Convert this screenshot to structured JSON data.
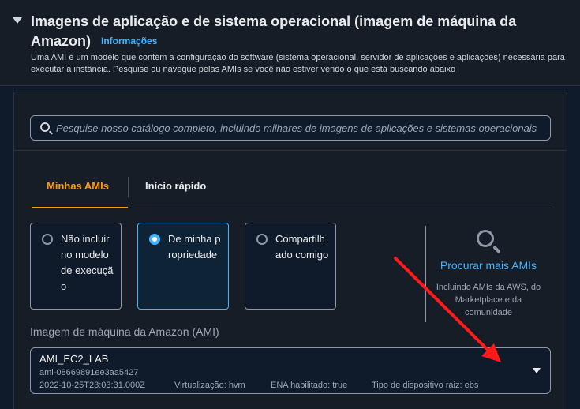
{
  "header": {
    "title": "Imagens de aplicação e de sistema operacional (imagem de máquina da Amazon)",
    "info_link": "Informações",
    "description": "Uma AMI é um modelo que contém a configuração do software (sistema operacional, servidor de aplicações e aplicações) necessária para executar a instância. Pesquise ou navegue pelas AMIs se você não estiver vendo o que está buscando abaixo"
  },
  "search": {
    "placeholder": "Pesquise nosso catálogo completo, incluindo milhares de imagens de aplicações e sistemas operacionais",
    "icon": "search-icon"
  },
  "tabs": [
    {
      "label": "Minhas AMIs",
      "active": true
    },
    {
      "label": "Início rápido",
      "active": false
    }
  ],
  "ownership_options": [
    {
      "label": "Não incluir no modelo de execução",
      "selected": false
    },
    {
      "label": "De minha propriedade",
      "selected": true
    },
    {
      "label": "Compartilhado comigo",
      "selected": false
    }
  ],
  "browse": {
    "link": "Procurar mais AMIs",
    "description": "Incluindo AMIs da AWS, do Marketplace e da comunidade"
  },
  "ami": {
    "label": "Imagem de máquina da Amazon (AMI)",
    "name": "AMI_EC2_LAB",
    "id": "ami-08669891ee3aa5427",
    "date": "2022-10-25T23:03:31.000Z",
    "virtualization": "Virtualização: hvm",
    "ena": "ENA habilitado: true",
    "root_device": "Tipo de dispositivo raiz: ebs"
  },
  "colors": {
    "accent": "#ff9900",
    "link": "#42b4ff",
    "annotation_arrow": "#ff1a1a"
  }
}
